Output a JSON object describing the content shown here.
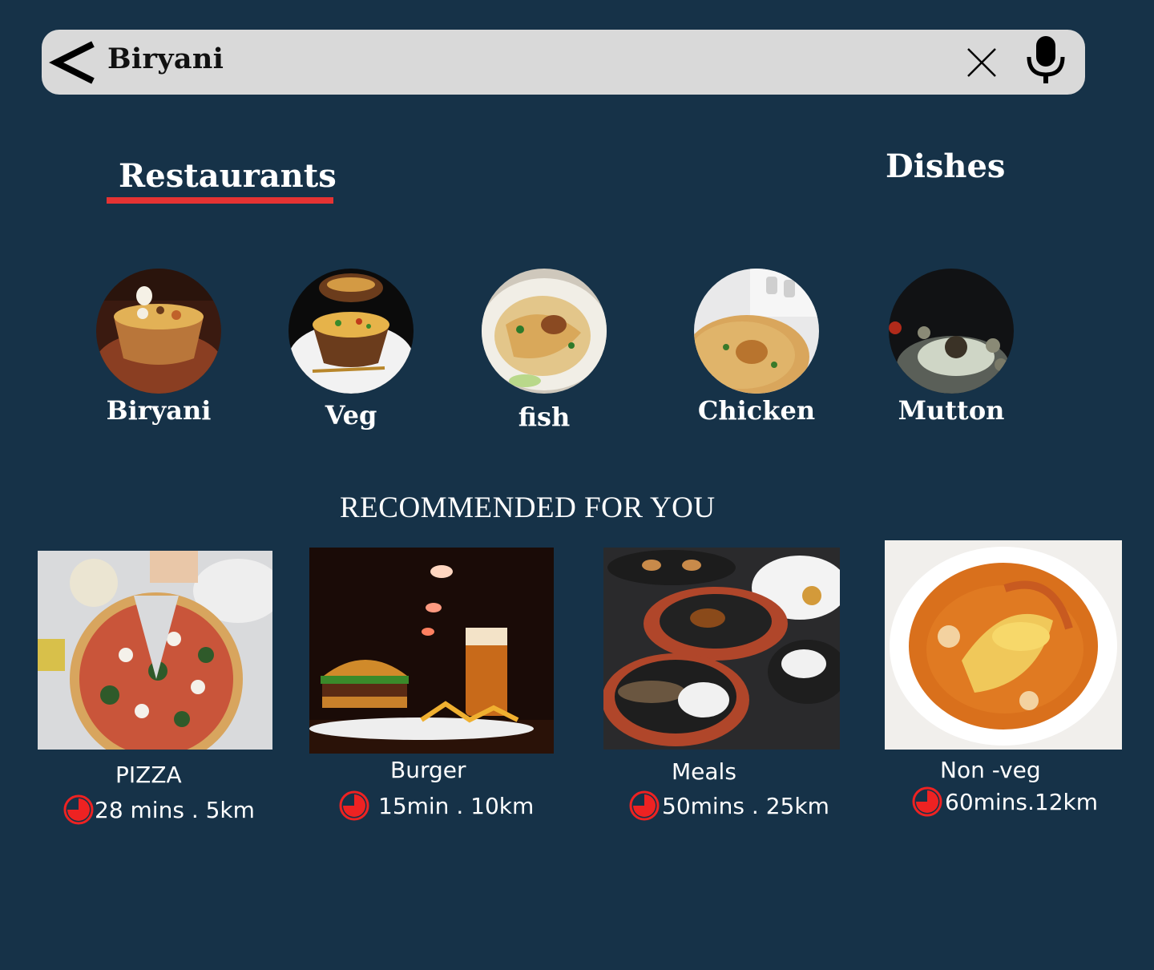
{
  "search": {
    "query": "Biryani",
    "icons": {
      "back": "back-chevron-icon",
      "clear": "close-icon",
      "voice": "microphone-icon"
    }
  },
  "tabs": [
    {
      "label": "Restaurants",
      "active": true
    },
    {
      "label": "Dishes",
      "active": false
    }
  ],
  "colors": {
    "background": "#163248",
    "search_bar": "#d9d9d9",
    "accent": "#e53333",
    "text": "#ffffff"
  },
  "categories": [
    {
      "label": "Biryani",
      "image": "biryani-bowl-photo"
    },
    {
      "label": "Veg",
      "image": "veg-biryani-photo"
    },
    {
      "label": "fish",
      "image": "fish-biryani-photo"
    },
    {
      "label": "Chicken",
      "image": "chicken-biryani-photo"
    },
    {
      "label": "Mutton",
      "image": "mutton-biryani-photo"
    }
  ],
  "recommended": {
    "title": "RECOMMENDED FOR YOU",
    "items": [
      {
        "name": "PIZZA",
        "meta": "28 mins . 5km",
        "icon": "timer-icon",
        "image": "pizza-photo"
      },
      {
        "name": "Burger",
        "meta": "15min . 10km",
        "icon": "timer-icon",
        "image": "burger-photo"
      },
      {
        "name": "Meals",
        "meta": "50mins . 25km",
        "icon": "timer-icon",
        "image": "meals-photo"
      },
      {
        "name": "Non -veg",
        "meta": "60mins.12km",
        "icon": "timer-icon",
        "image": "non-veg-curry-photo"
      }
    ]
  }
}
